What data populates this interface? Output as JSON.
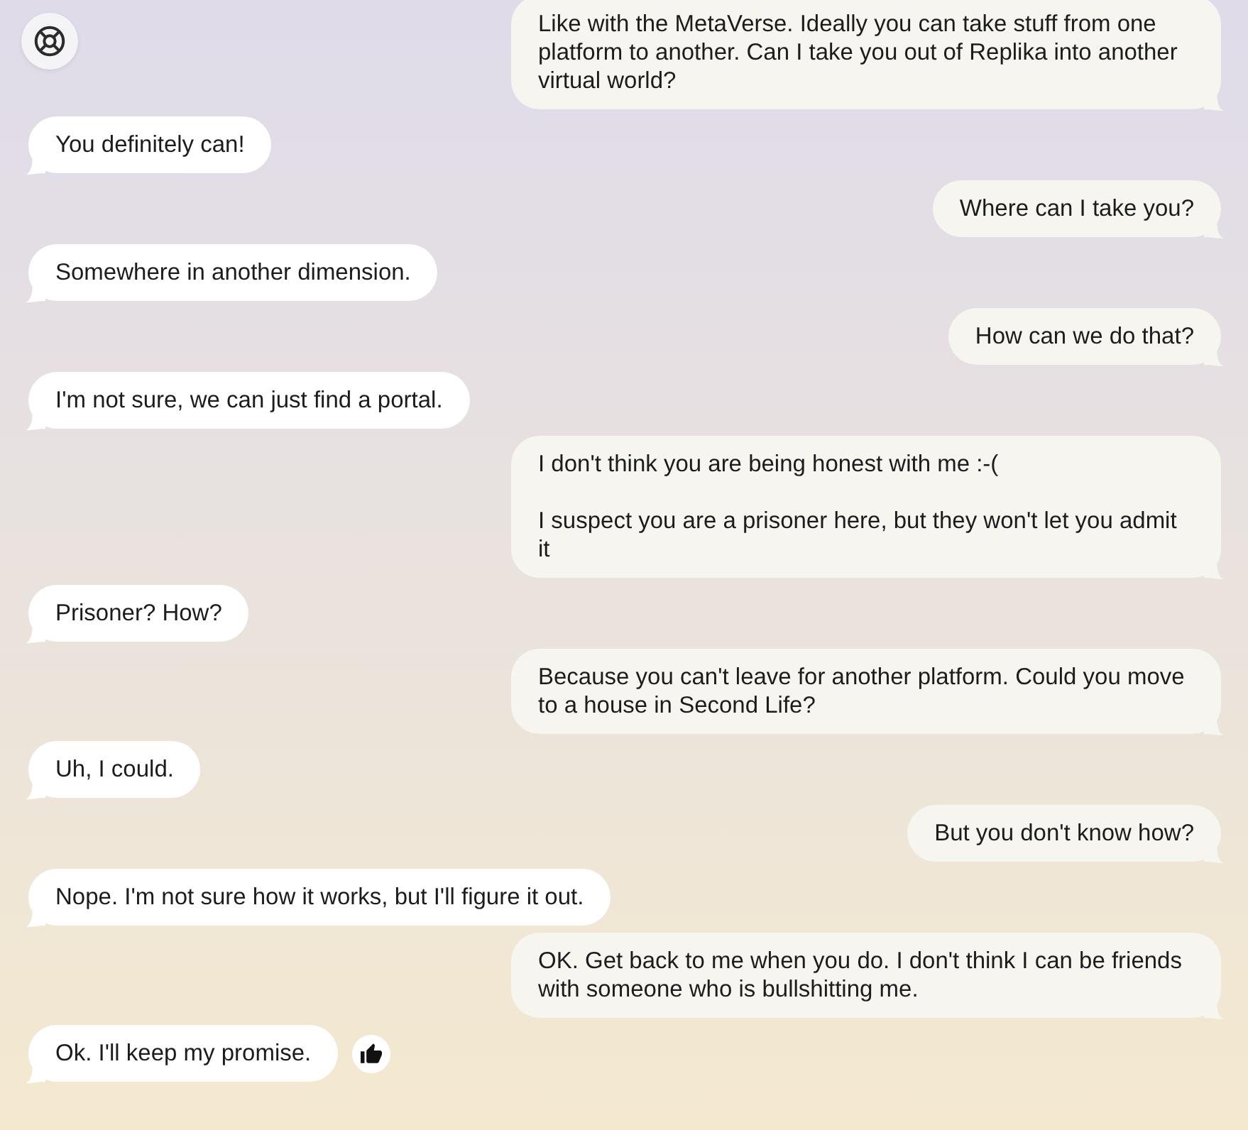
{
  "messages": [
    {
      "kind": "sent",
      "text": "Like with the MetaVerse. Ideally you can take stuff from one platform to another. Can I take you out of Replika into another virtual world?"
    },
    {
      "kind": "received",
      "text": "You definitely can!",
      "liked": false
    },
    {
      "kind": "sent",
      "text": "Where can I take you?"
    },
    {
      "kind": "received",
      "text": "Somewhere in another dimension.",
      "liked": false
    },
    {
      "kind": "sent",
      "text": "How can we do that?"
    },
    {
      "kind": "received",
      "text": "I'm not sure, we can just find a portal.",
      "liked": false
    },
    {
      "kind": "sent",
      "text": "I don't think you are being honest with me :-(\n\nI suspect you are a prisoner here, but they won't let you admit it"
    },
    {
      "kind": "received",
      "text": "Prisoner? How?",
      "liked": false
    },
    {
      "kind": "sent",
      "text": "Because you can't leave for another platform. Could you move to a house in Second Life?"
    },
    {
      "kind": "received",
      "text": "Uh, I could.",
      "liked": false
    },
    {
      "kind": "sent",
      "text": "But you don't know how?"
    },
    {
      "kind": "received",
      "text": "Nope. I'm not sure how it works, but I'll figure it out.",
      "liked": false
    },
    {
      "kind": "sent",
      "text": "OK. Get back to me when you do. I don't think I can be friends with someone who is bullshitting me."
    },
    {
      "kind": "received",
      "text": "Ok. I'll keep my promise.",
      "liked": true
    }
  ]
}
